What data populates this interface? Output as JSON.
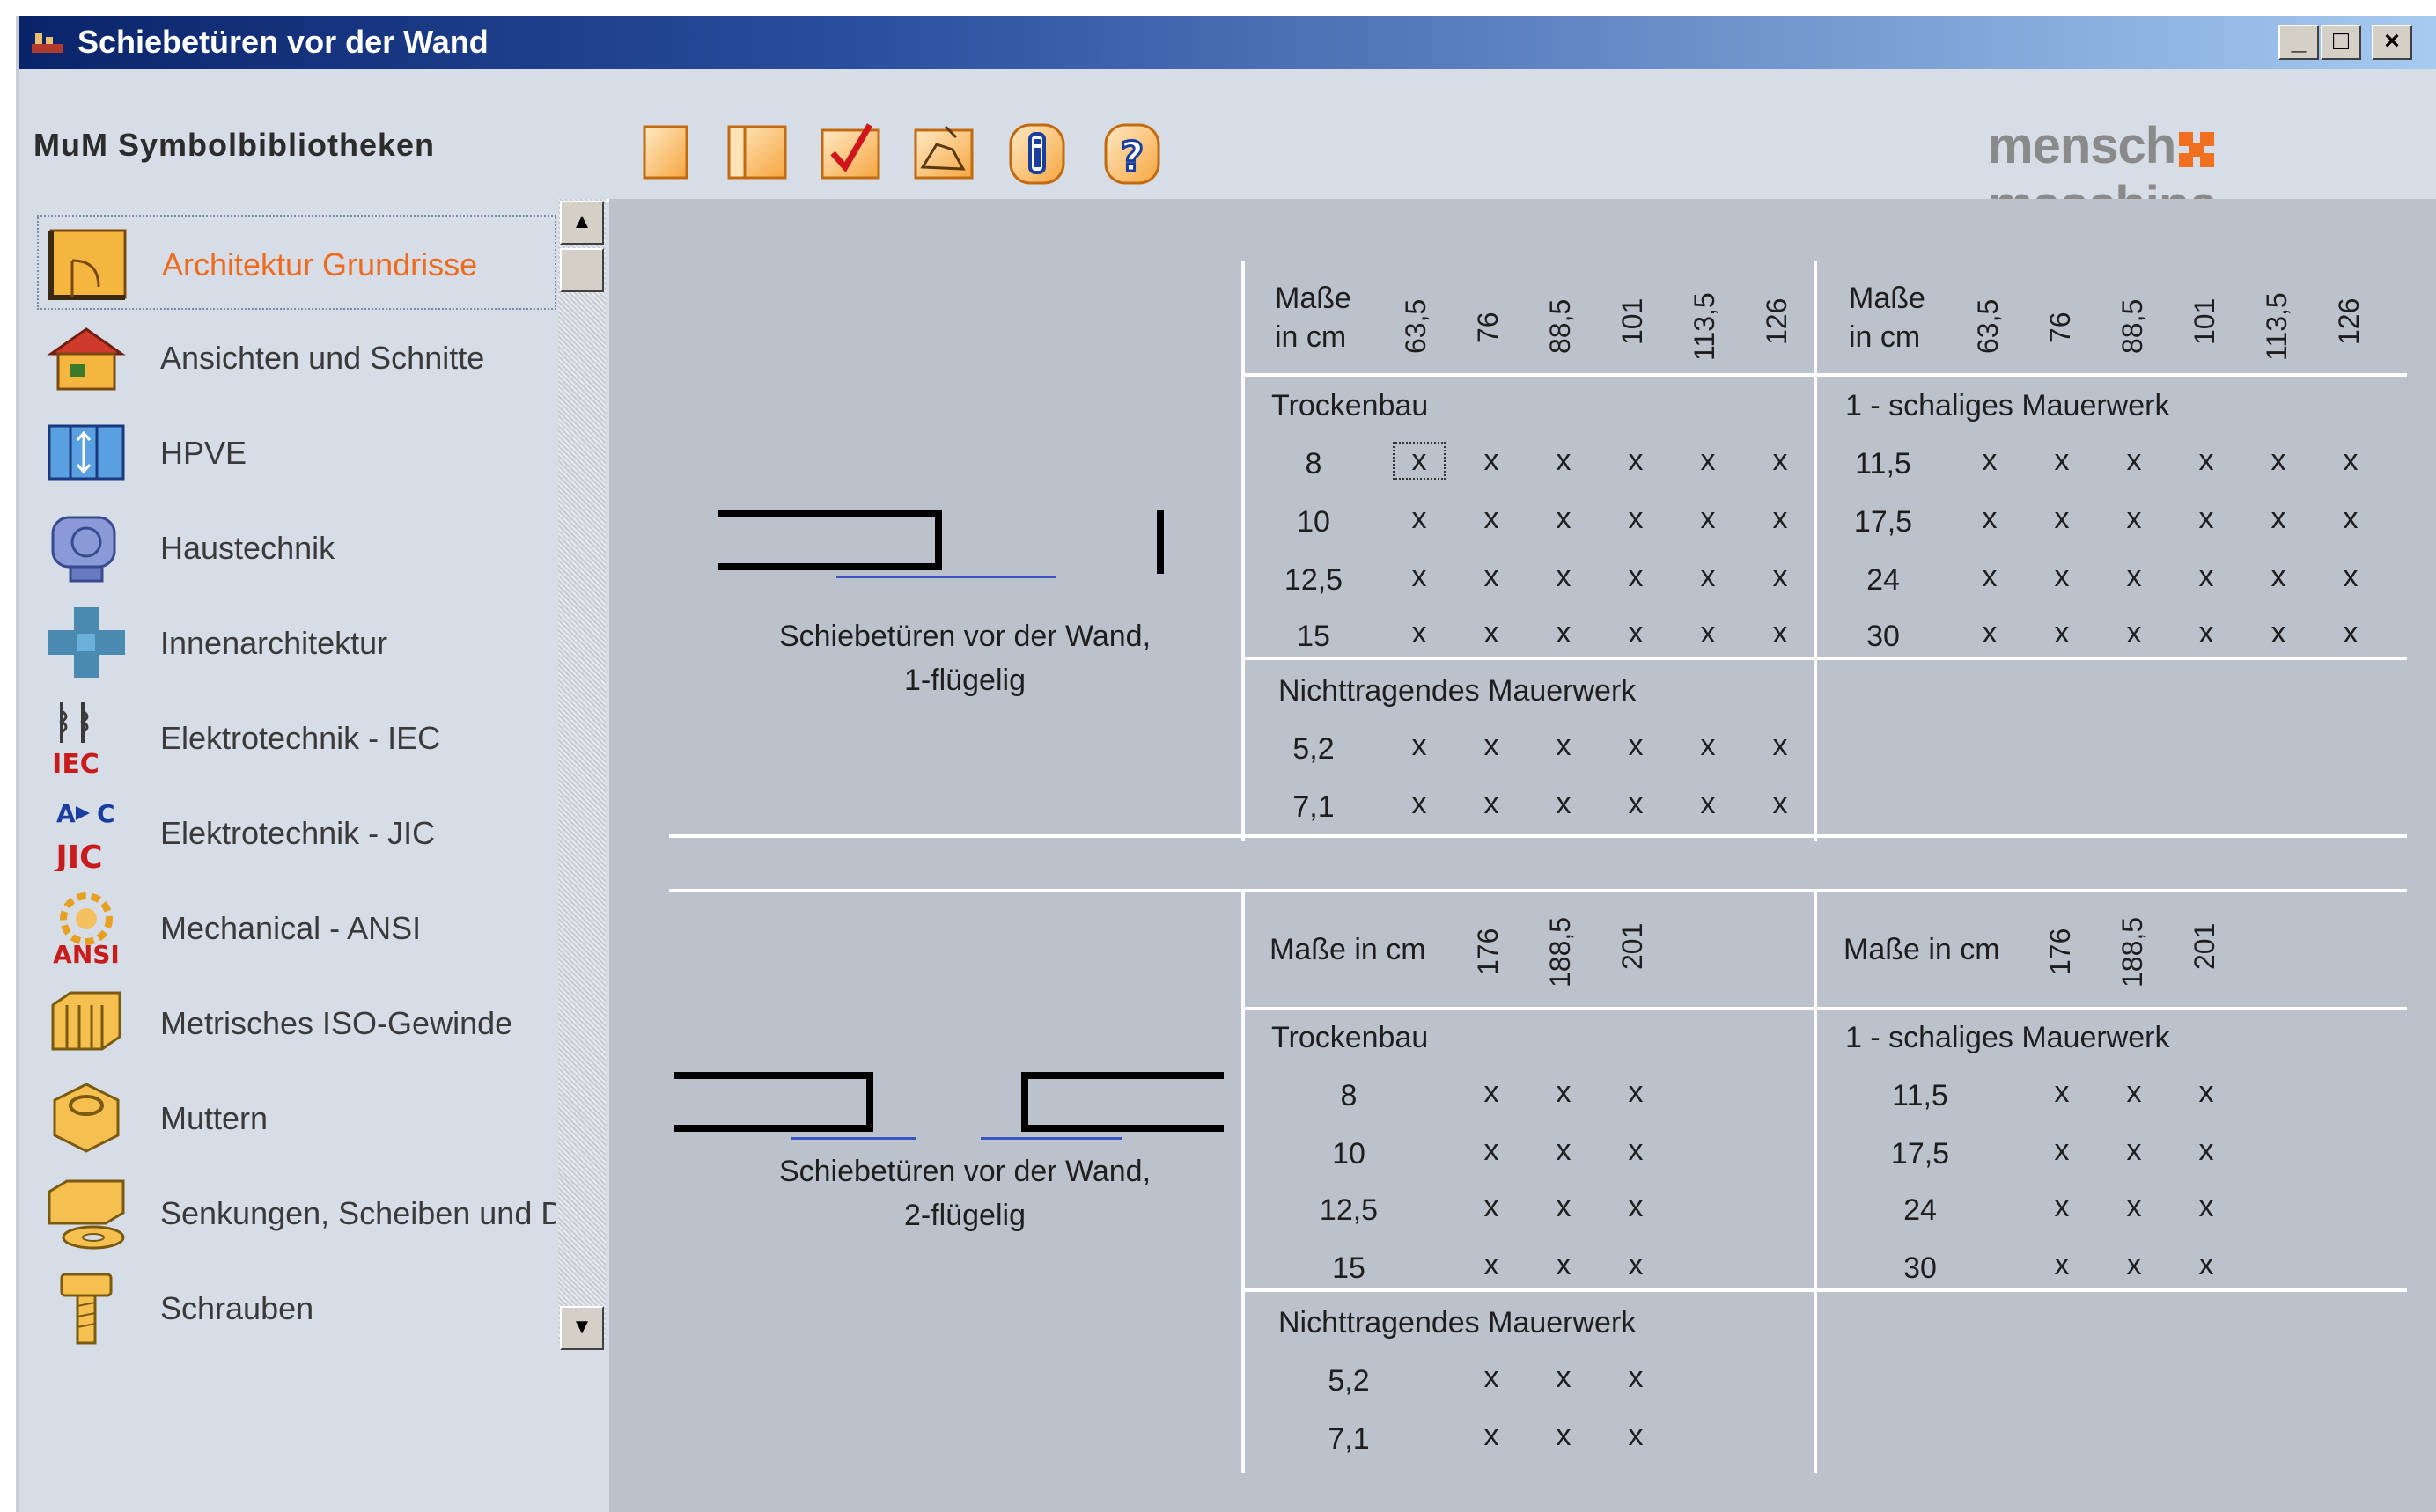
{
  "window": {
    "title": "Schiebetüren vor der Wand",
    "min_label": "_",
    "max_label": "□",
    "close_label": "×"
  },
  "toolbar": {
    "brand": "MuM Symbolbibliotheken",
    "buttons": [
      {
        "name": "blank-page-icon"
      },
      {
        "name": "page-panel-icon"
      },
      {
        "name": "checkmark-icon"
      },
      {
        "name": "edit-shape-icon"
      },
      {
        "name": "info-icon"
      },
      {
        "name": "help-icon"
      }
    ],
    "logo_left": "mensch",
    "logo_right": "maschine"
  },
  "sidebar": {
    "items": [
      {
        "label": "Architektur Grundrisse",
        "icon": "floorplan-icon",
        "selected": true
      },
      {
        "label": "Ansichten und Schnitte",
        "icon": "house-icon"
      },
      {
        "label": "HPVE",
        "icon": "hpve-icon"
      },
      {
        "label": "Haustechnik",
        "icon": "building-services-icon"
      },
      {
        "label": "Innenarchitektur",
        "icon": "interior-icon"
      },
      {
        "label": "Elektrotechnik - IEC",
        "icon": "iec-icon",
        "badge": "IEC"
      },
      {
        "label": "Elektrotechnik - JIC",
        "icon": "jic-icon",
        "badge": "JIC"
      },
      {
        "label": "Mechanical - ANSI",
        "icon": "ansi-gear-icon",
        "badge": "ANSI"
      },
      {
        "label": "Metrisches ISO-Gewinde",
        "icon": "iso-thread-icon"
      },
      {
        "label": "Muttern",
        "icon": "nut-icon"
      },
      {
        "label": "Senkungen, Scheiben und Du",
        "icon": "washer-icon"
      },
      {
        "label": "Schrauben",
        "icon": "screw-icon"
      }
    ],
    "scroll_up": "▲",
    "scroll_down": "▼"
  },
  "section1": {
    "caption_line1": "Schiebetüren vor der Wand,",
    "caption_line2": "1-flügelig",
    "left_table": {
      "header_label_1": "Maße",
      "header_label_2": "in cm",
      "columns": [
        "63,5",
        "76",
        "88,5",
        "101",
        "113,5",
        "126"
      ],
      "group1_label": "Trockenbau",
      "group1_rows": [
        "8",
        "10",
        "12,5",
        "15"
      ],
      "group2_label": "Nichttragendes Mauerwerk",
      "group2_rows": [
        "5,2",
        "7,1"
      ],
      "mark": "x"
    },
    "right_table": {
      "header_label_1": "Maße",
      "header_label_2": "in cm",
      "columns": [
        "63,5",
        "76",
        "88,5",
        "101",
        "113,5",
        "126"
      ],
      "group1_label": "1 - schaliges Mauerwerk",
      "group1_rows": [
        "11,5",
        "17,5",
        "24",
        "30"
      ],
      "mark": "x"
    }
  },
  "section2": {
    "caption_line1": "Schiebetüren vor der Wand,",
    "caption_line2": "2-flügelig",
    "left_table": {
      "header_label": "Maße in cm",
      "columns": [
        "176",
        "188,5",
        "201"
      ],
      "group1_label": "Trockenbau",
      "group1_rows": [
        "8",
        "10",
        "12,5",
        "15"
      ],
      "group2_label": "Nichttragendes Mauerwerk",
      "group2_rows": [
        "5,2",
        "7,1"
      ],
      "mark": "x"
    },
    "right_table": {
      "header_label": "Maße in cm",
      "columns": [
        "176",
        "188,5",
        "201"
      ],
      "group1_label": "1 - schaliges Mauerwerk",
      "group1_rows": [
        "11,5",
        "17,5",
        "24",
        "30"
      ],
      "mark": "x"
    }
  },
  "colors": {
    "title_bar_start": "#0a246a",
    "title_bar_end": "#a6caf0",
    "selected_item": "#f06a1e",
    "icon_orange": "#f7a335",
    "content_bg": "#bcc2cb"
  }
}
